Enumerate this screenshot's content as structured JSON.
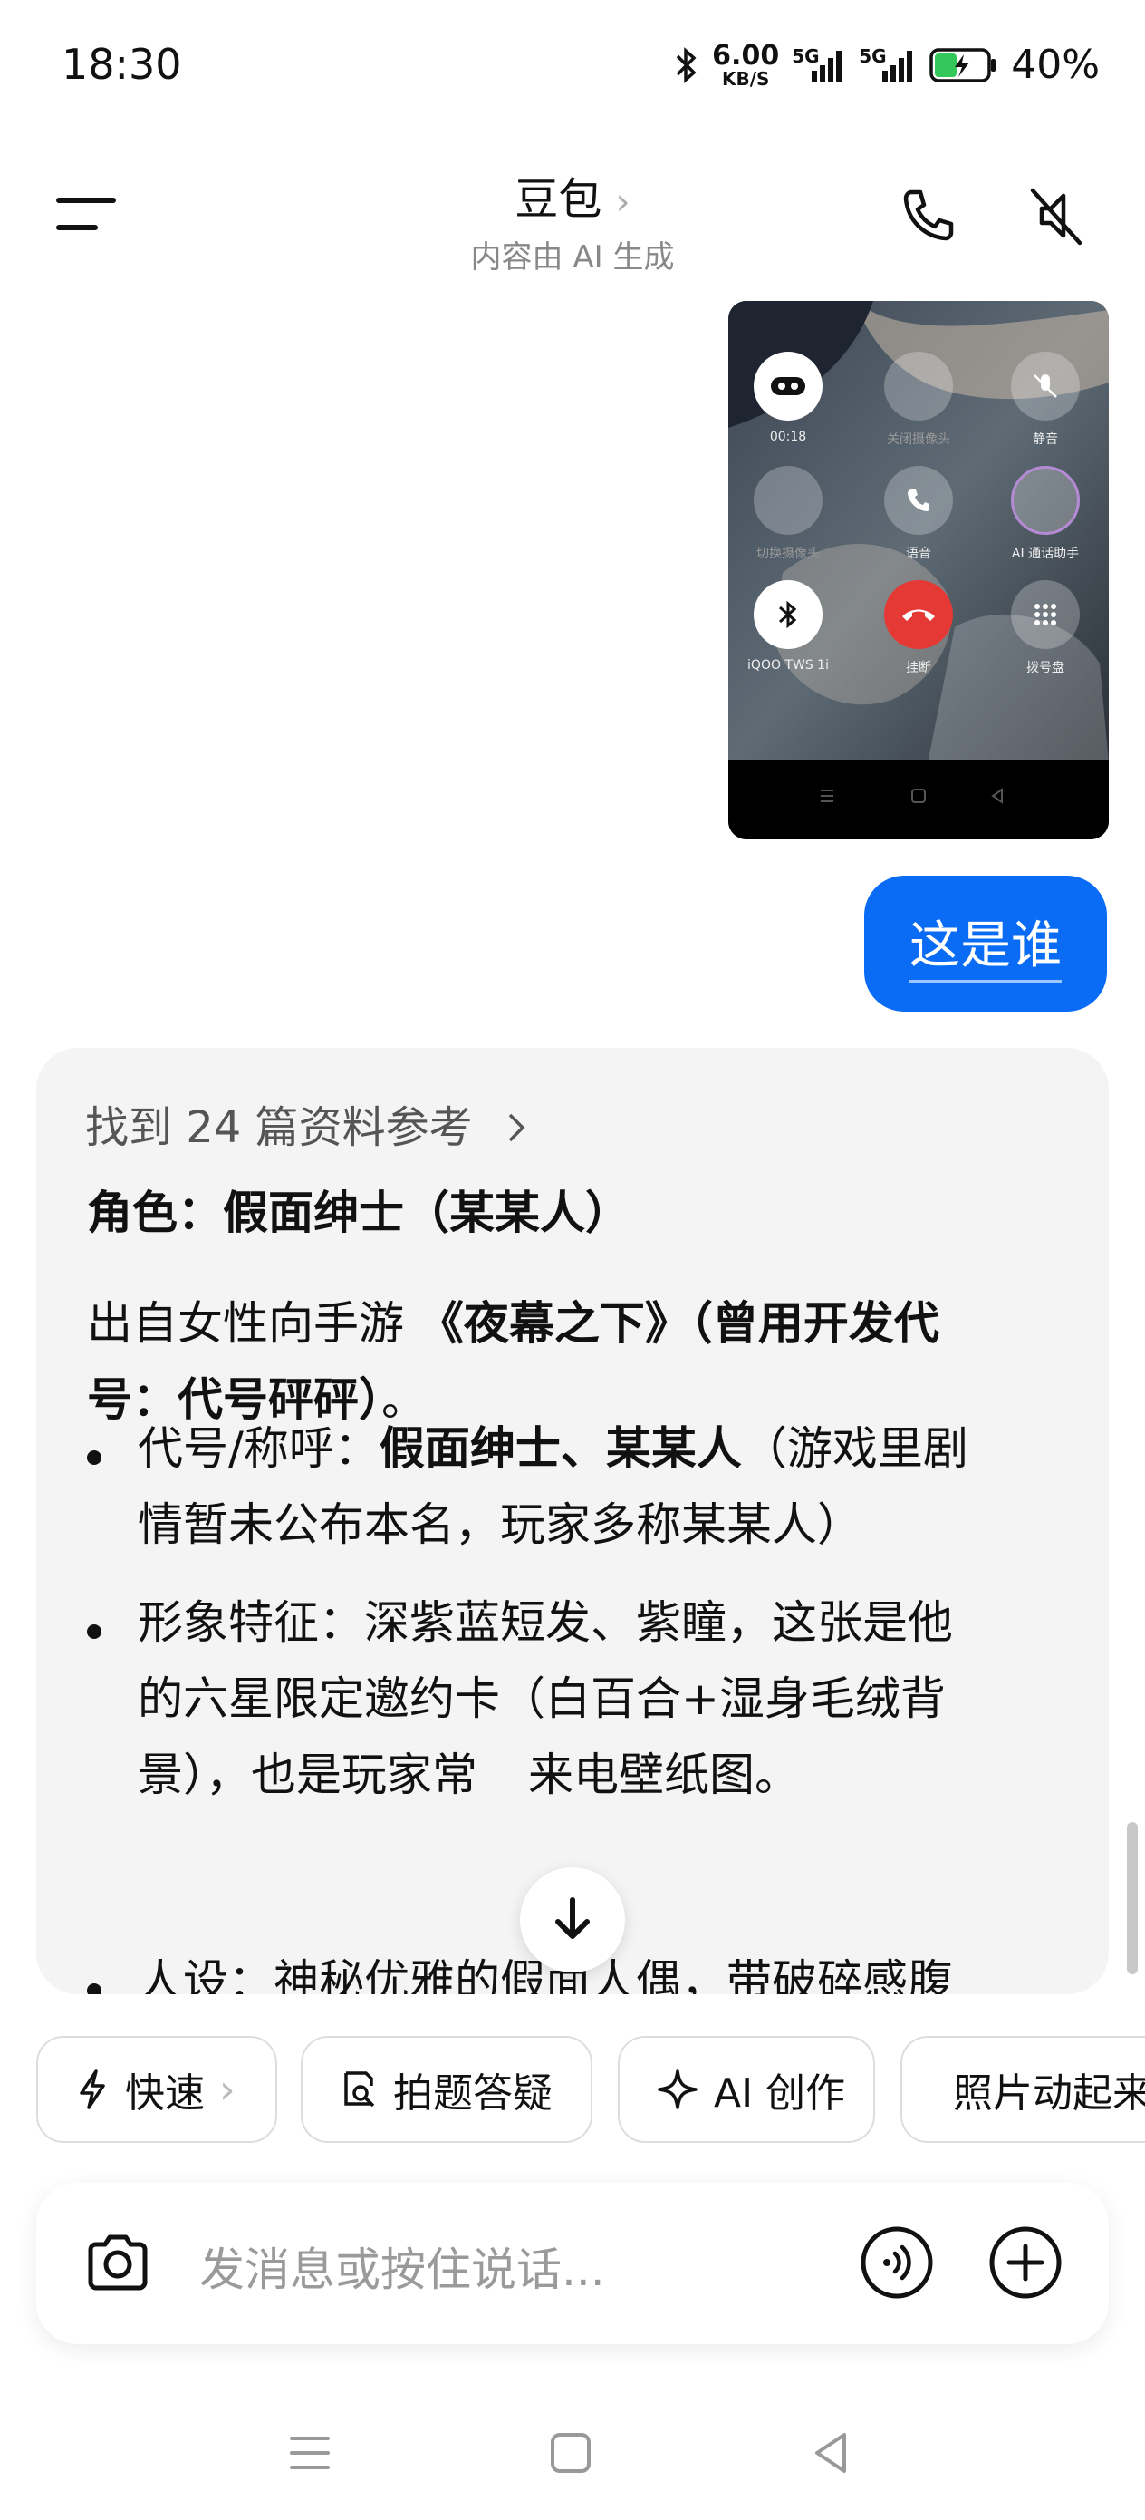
{
  "status_bar": {
    "time": "18:30",
    "net_speed_value": "6.00",
    "net_speed_unit": "KB/S",
    "sim1": "5G",
    "sim2": "5G",
    "battery": "40%"
  },
  "header": {
    "title": "豆包",
    "chevron": "›",
    "subtitle": "内容由 AI 生成"
  },
  "image_message": {
    "call_timer": "00:18",
    "buttons": [
      "关闭摄像头",
      "静音",
      "切换摄像头",
      "语音",
      "AI 通话助手",
      "iQOO TWS 1i",
      "挂断",
      "拨号盘"
    ]
  },
  "user_message": {
    "text": "这是谁"
  },
  "assistant": {
    "refs": "找到 24 篇资料参考",
    "heading_label": "角色：",
    "heading_bold": "假面绅士（某某人）",
    "p1_prefix": "出自女性向手游 ",
    "p1_bold_line1": "《夜幕之下》（曾用开发代",
    "p1_bold_line2": "号：代号砰砰）",
    "p1_suffix": "。",
    "b1_label": "代号/称呼：",
    "b1_bold": "假面绅士、某某人",
    "b1_rest_1": "（游戏里剧",
    "b1_rest_2": "情暂未公布本名，玩家多称某某人）",
    "b2_line1": "形象特征：深紫蓝短发、紫瞳，这张是他",
    "b2_line2": "的六星限定邀约卡（白百合+湿身毛绒背",
    "b2_line3": "景），也是玩家常",
    "b2_line3_end": "来电壁纸图。",
    "b3_partial": "人设：神秘优雅的假面人偶，带破碎感腹"
  },
  "chips": [
    {
      "label": "快速",
      "icon": "bolt-icon"
    },
    {
      "label": "拍题答疑",
      "icon": "photo-search-icon"
    },
    {
      "label": "AI 创作",
      "icon": "sparkle-icon"
    },
    {
      "label": "照片动起来",
      "icon": "play-icon"
    }
  ],
  "input": {
    "placeholder": "发消息或按住说话..."
  },
  "colors": {
    "accent": "#0a6cf5",
    "card_bg": "#f4f4f5",
    "hangup": "#e53935"
  }
}
